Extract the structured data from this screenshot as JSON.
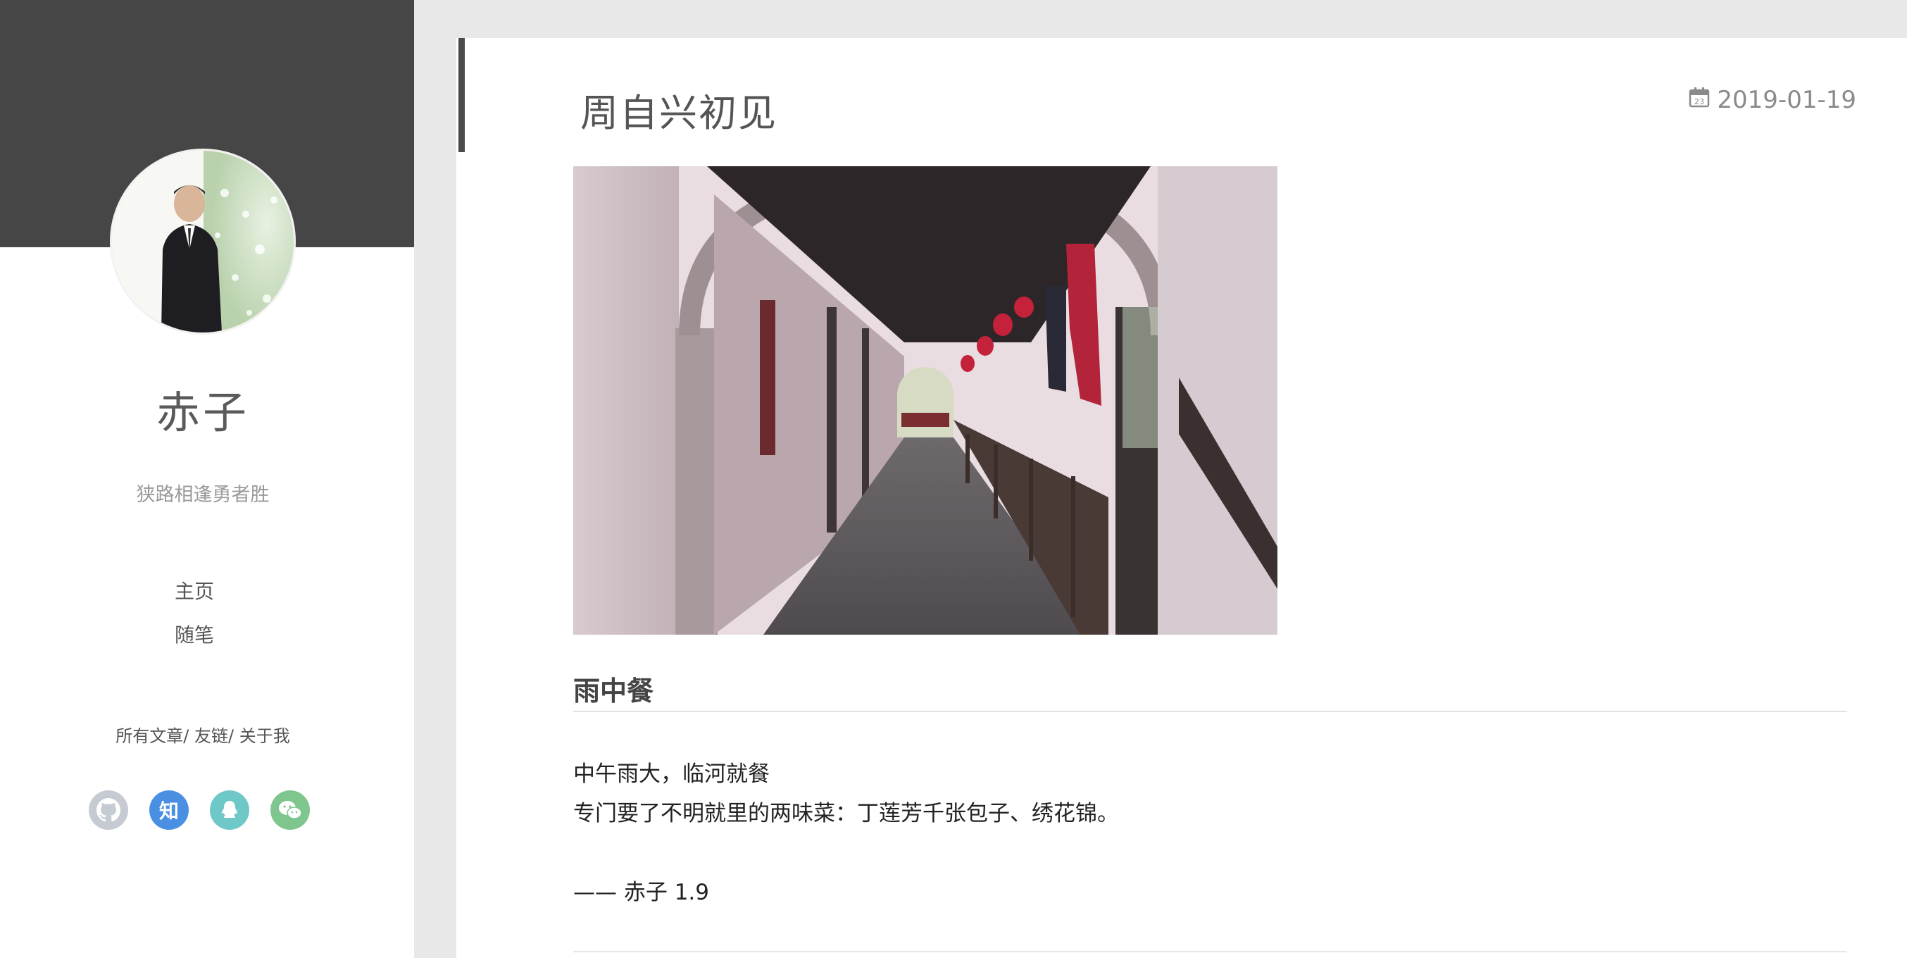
{
  "sidebar": {
    "author_name": "赤子",
    "motto": "狭路相逢勇者胜",
    "nav": [
      {
        "label": "主页"
      },
      {
        "label": "随笔"
      }
    ],
    "links": [
      {
        "label": "所有文章"
      },
      {
        "label": "友链"
      },
      {
        "label": "关于我"
      }
    ],
    "link_separator": "/ ",
    "socials": [
      {
        "name": "github",
        "icon": "github-icon",
        "color": "#c5cad3"
      },
      {
        "name": "zhihu",
        "icon": "zhihu-icon",
        "glyph": "知",
        "color": "#4a90e2"
      },
      {
        "name": "qq",
        "icon": "qq-icon",
        "color": "#6fc8c8"
      },
      {
        "name": "wechat",
        "icon": "wechat-icon",
        "color": "#7fc68e"
      }
    ]
  },
  "post": {
    "title": "周自兴初见",
    "date": "2019-01-19",
    "section_heading": "雨中餐",
    "paragraphs": [
      "中午雨大，临河就餐",
      "专门要了不明就里的两味菜：丁莲芳千张包子、绣花锦。",
      "—— 赤子 1.9"
    ]
  },
  "colors": {
    "banner": "#464646",
    "page_bg": "#e8e8e8",
    "accent_bar": "#4a4a4a"
  }
}
